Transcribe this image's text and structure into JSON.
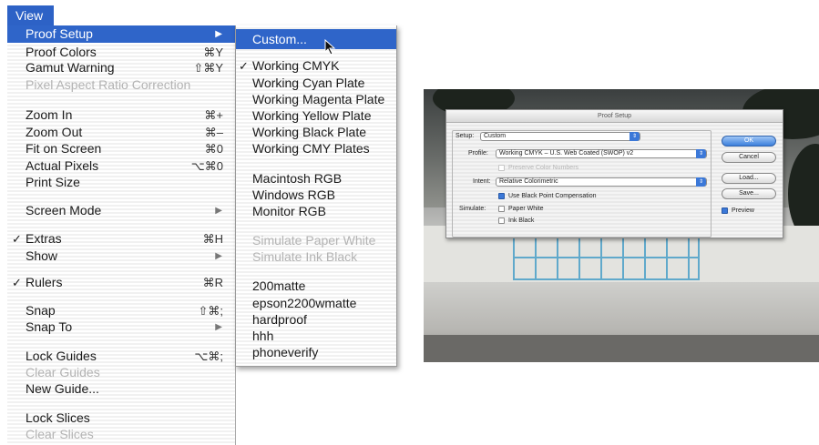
{
  "view_menu": {
    "title": "View",
    "items": [
      {
        "label": "Proof Setup",
        "shortcut": "",
        "submenu": true,
        "highlighted": true
      },
      {
        "label": "Proof Colors",
        "shortcut": "⌘Y"
      },
      {
        "label": "Gamut Warning",
        "shortcut": "⇧⌘Y"
      },
      {
        "label": "Pixel Aspect Ratio Correction",
        "disabled": true
      },
      {
        "label": "Zoom In",
        "shortcut": "⌘+"
      },
      {
        "label": "Zoom Out",
        "shortcut": "⌘–"
      },
      {
        "label": "Fit on Screen",
        "shortcut": "⌘0"
      },
      {
        "label": "Actual Pixels",
        "shortcut": "⌥⌘0"
      },
      {
        "label": "Print Size"
      },
      {
        "label": "Screen Mode",
        "submenu": true
      },
      {
        "label": "Extras",
        "shortcut": "⌘H",
        "checked": true
      },
      {
        "label": "Show",
        "submenu": true
      },
      {
        "label": "Rulers",
        "shortcut": "⌘R",
        "checked": true
      },
      {
        "label": "Snap",
        "shortcut": "⇧⌘;"
      },
      {
        "label": "Snap To",
        "submenu": true
      },
      {
        "label": "Lock Guides",
        "shortcut": "⌥⌘;"
      },
      {
        "label": "Clear Guides",
        "disabled": true
      },
      {
        "label": "New Guide..."
      },
      {
        "label": "Lock Slices"
      },
      {
        "label": "Clear Slices",
        "disabled": true
      }
    ],
    "check_mark": "✓",
    "submenu_arrow": "▶"
  },
  "proof_submenu": {
    "items": [
      {
        "label": "Custom...",
        "highlighted": true
      },
      {
        "label": "Working CMYK",
        "checked": true
      },
      {
        "label": "Working Cyan Plate"
      },
      {
        "label": "Working Magenta Plate"
      },
      {
        "label": "Working Yellow Plate"
      },
      {
        "label": "Working Black Plate"
      },
      {
        "label": "Working CMY Plates"
      },
      {
        "label": "Macintosh RGB"
      },
      {
        "label": "Windows RGB"
      },
      {
        "label": "Monitor RGB"
      },
      {
        "label": "Simulate Paper White",
        "disabled": true
      },
      {
        "label": "Simulate Ink Black",
        "disabled": true
      },
      {
        "label": "200matte"
      },
      {
        "label": "epson2200wmatte"
      },
      {
        "label": "hardproof"
      },
      {
        "label": "hhh"
      },
      {
        "label": "phoneverify"
      }
    ]
  },
  "proof_dialog": {
    "title": "Proof Setup",
    "setup_label": "Setup:",
    "setup_value": "Custom",
    "profile_label": "Profile:",
    "profile_value": "Working CMYK – U.S. Web Coated (SWOP) v2",
    "preserve_label": "Preserve Color Numbers",
    "intent_label": "Intent:",
    "intent_value": "Relative Colorimetric",
    "black_point_label": "Use Black Point Compensation",
    "simulate_label": "Simulate:",
    "paper_white_label": "Paper White",
    "ink_black_label": "Ink Black",
    "ok_label": "OK",
    "cancel_label": "Cancel",
    "load_label": "Load...",
    "save_label": "Save...",
    "preview_label": "Preview",
    "popup_arrow": "⇕"
  },
  "colors": {
    "menu_highlight": "#2f65c9",
    "gate_accent": "#4aa0c8"
  }
}
